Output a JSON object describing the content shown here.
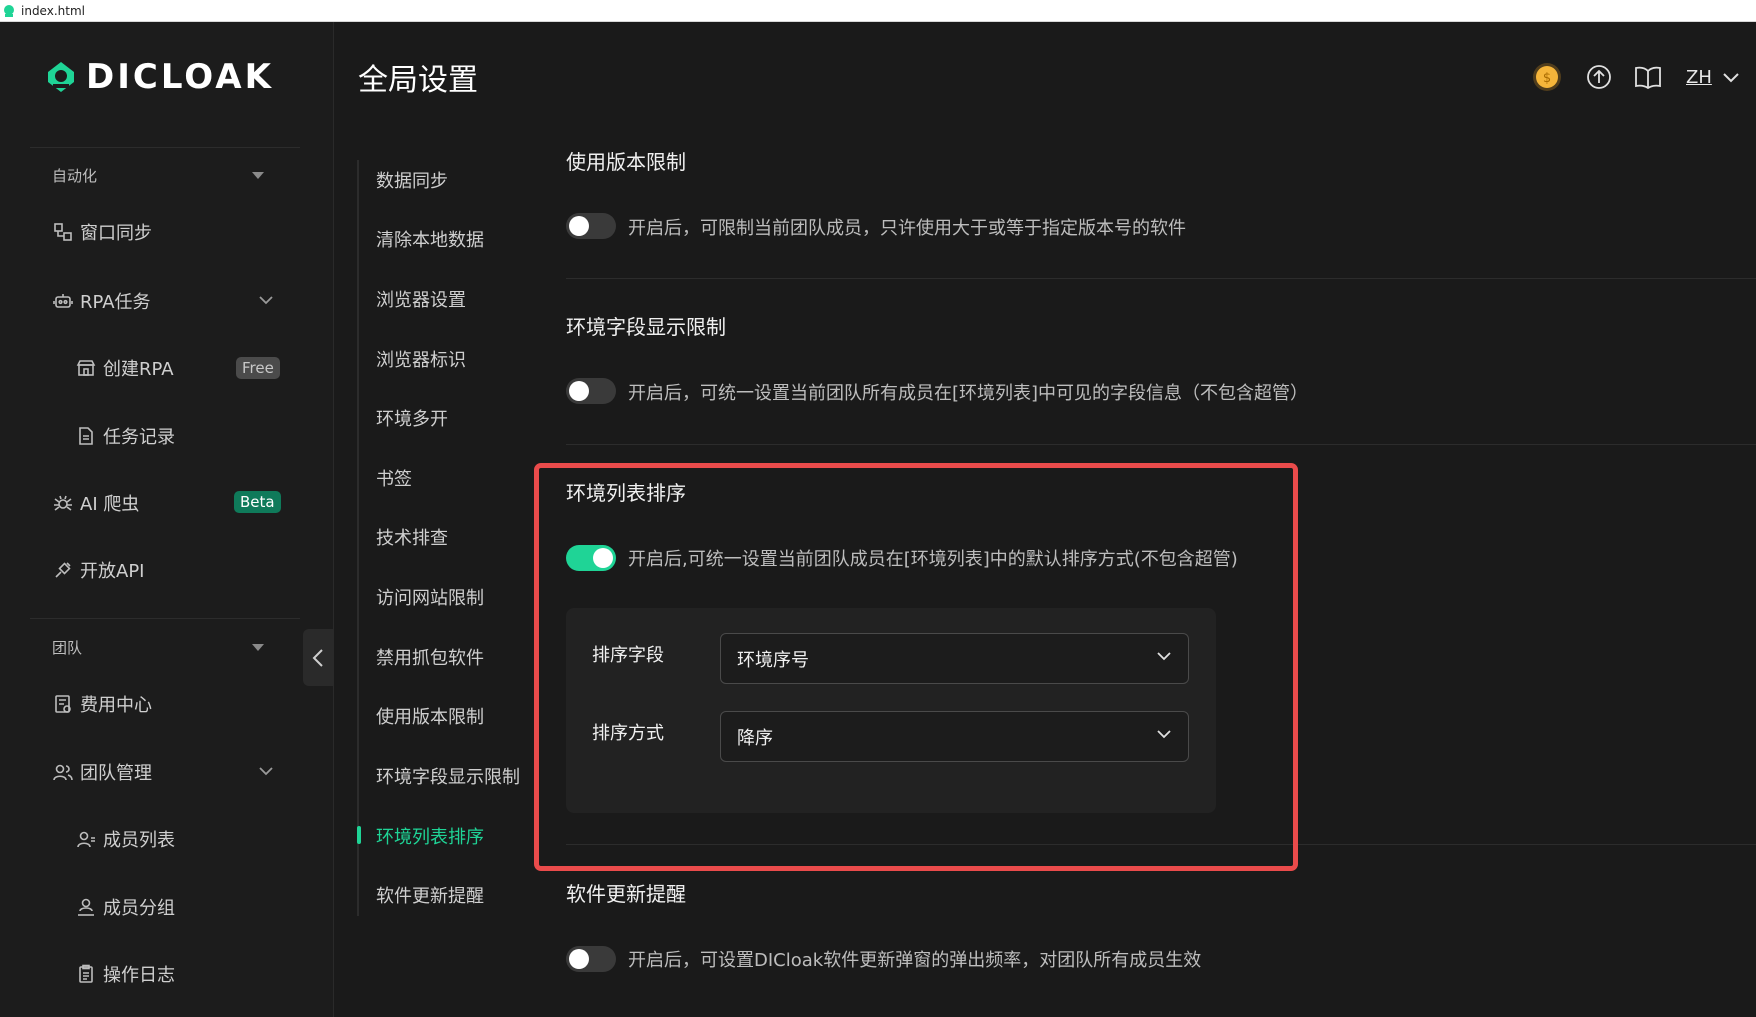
{
  "window": {
    "title": "index.html"
  },
  "brand": {
    "logo_text": "DICLOAK",
    "accent": "#1fd496"
  },
  "sidebar": {
    "groups": [
      {
        "label": "自动化"
      },
      {
        "label": "团队"
      }
    ],
    "items": [
      {
        "label": "窗口同步",
        "icon": "window-sync-icon"
      },
      {
        "label": "RPA任务",
        "icon": "robot-icon"
      },
      {
        "label": "创建RPA",
        "icon": "store-icon",
        "badge": "Free"
      },
      {
        "label": "任务记录",
        "icon": "document-icon"
      },
      {
        "label": "AI 爬虫",
        "icon": "spider-icon",
        "badge": "Beta"
      },
      {
        "label": "开放API",
        "icon": "api-plug-icon"
      },
      {
        "label": "费用中心",
        "icon": "billing-icon"
      },
      {
        "label": "团队管理",
        "icon": "users-icon"
      },
      {
        "label": "成员列表",
        "icon": "user-list-icon"
      },
      {
        "label": "成员分组",
        "icon": "user-group-icon"
      },
      {
        "label": "操作日志",
        "icon": "clipboard-icon"
      }
    ]
  },
  "header": {
    "title": "全局设置",
    "language": "ZH",
    "icons": [
      "coin-icon",
      "upload-icon",
      "book-icon",
      "chevron-down-icon"
    ]
  },
  "subnav": {
    "items": [
      "数据同步",
      "清除本地数据",
      "浏览器设置",
      "浏览器标识",
      "环境多开",
      "书签",
      "技术排查",
      "访问网站限制",
      "禁用抓包软件",
      "使用版本限制",
      "环境字段显示限制",
      "环境列表排序",
      "软件更新提醒"
    ],
    "active": "环境列表排序"
  },
  "sections": {
    "version_limit": {
      "title_partial": "使用版本限制",
      "description": "开启后，可限制当前团队成员，只许使用大于或等于指定版本号的软件",
      "enabled": false
    },
    "field_display": {
      "title": "环境字段显示限制",
      "description": "开启后，可统一设置当前团队所有成员在[环境列表]中可见的字段信息（不包含超管）",
      "enabled": false
    },
    "list_sort": {
      "title": "环境列表排序",
      "description": "开启后,可统一设置当前团队成员在[环境列表]中的默认排序方式(不包含超管)",
      "enabled": true,
      "sort_field_label": "排序字段",
      "sort_field_value": "环境序号",
      "sort_order_label": "排序方式",
      "sort_order_value": "降序"
    },
    "update_reminder": {
      "title": "软件更新提醒",
      "description": "开启后，可设置DICloak软件更新弹窗的弹出频率，对团队所有成员生效",
      "enabled": false
    }
  },
  "highlight_color": "#ea4b4b"
}
